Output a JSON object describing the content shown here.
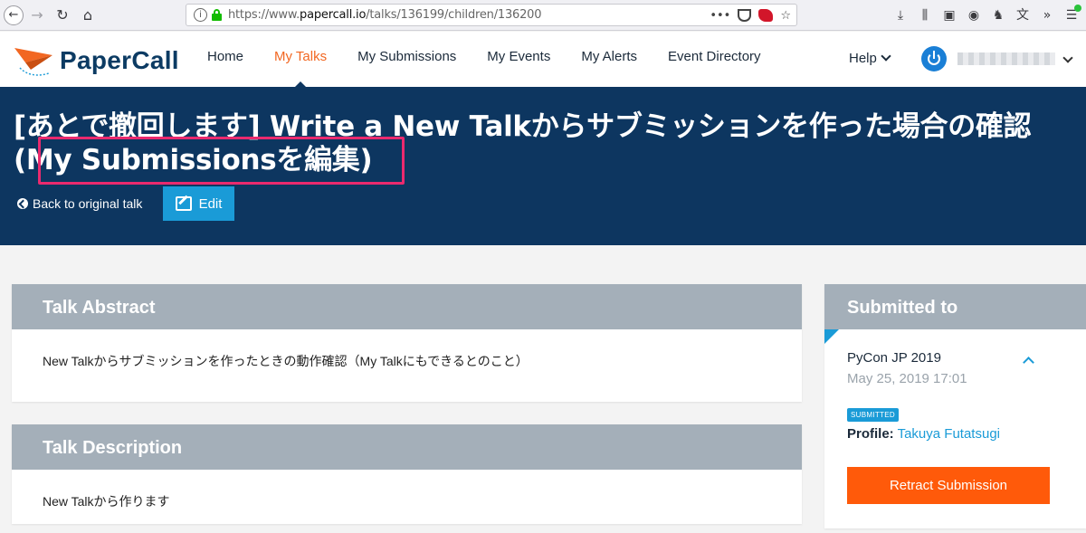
{
  "browser": {
    "url_prefix": "https://www.",
    "url_domain": "papercall.io",
    "url_path": "/talks/136199/children/136200",
    "more_label": "•••"
  },
  "header": {
    "brand": "PaperCall",
    "nav": [
      "Home",
      "My Talks",
      "My Submissions",
      "My Events",
      "My Alerts",
      "Event Directory"
    ],
    "active_nav": "My Talks",
    "help_label": "Help"
  },
  "hero": {
    "title": "[あとで撤回します] Write a New Talkからサブミッションを作った場合の確認(My Submissionsを編集)",
    "back_label": "Back to original talk",
    "edit_label": "Edit"
  },
  "abstract": {
    "heading": "Talk Abstract",
    "body": "New Talkからサブミッションを作ったときの動作確認（My Talkにもできるとのこと）"
  },
  "description": {
    "heading": "Talk Description",
    "body": "New Talkから作ります"
  },
  "submitted": {
    "heading": "Submitted to",
    "event": "PyCon JP 2019",
    "date": "May 25, 2019 17:01",
    "status": "SUBMITTED",
    "profile_label": "Profile:",
    "profile_name": "Takuya Futatsugi",
    "retract_label": "Retract Submission"
  },
  "colors": {
    "navy": "#0d3660",
    "accent_orange": "#f26722",
    "blue": "#1a9bd7",
    "retract": "#ff5a0a",
    "panel_head": "#a4afb9",
    "highlight": "#ea2a6e"
  }
}
